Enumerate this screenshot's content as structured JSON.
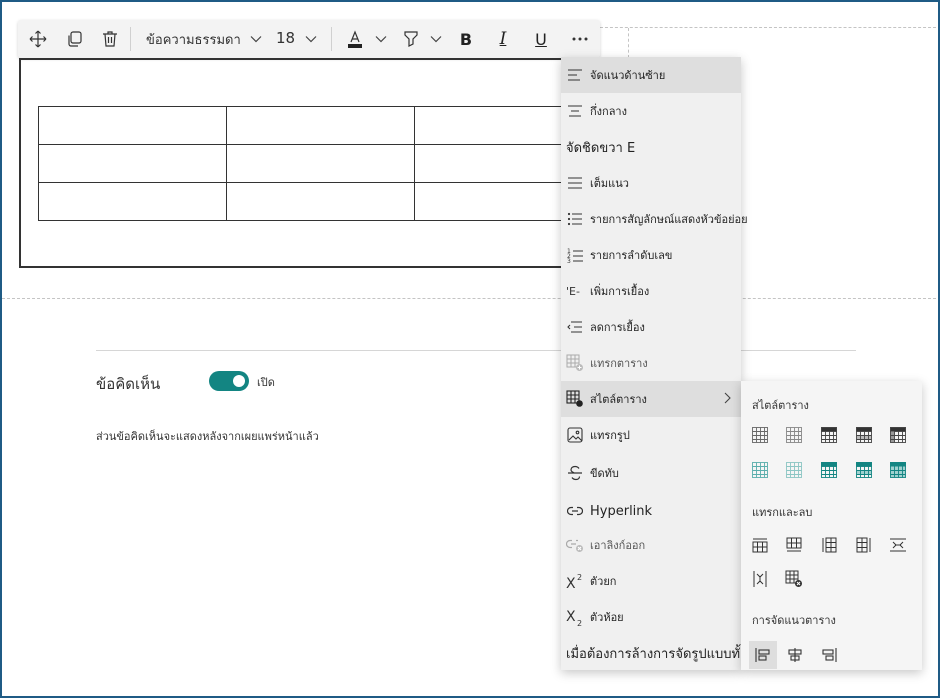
{
  "toolbar": {
    "style_value": "ข้อความธรรมดา",
    "size_value": "18",
    "icons": [
      "move-icon",
      "copy-icon",
      "delete-icon",
      "chevron-down-icon",
      "font-color-icon",
      "highlight-icon",
      "bold-icon",
      "italic-icon",
      "underline-icon",
      "more-icon"
    ]
  },
  "comments": {
    "label": "ข้อคิดเห็น",
    "toggle_label": "เปิด",
    "toggle_on": true,
    "note": "ส่วนข้อคิดเห็นจะแสดงหลังจากเผยแพร่หน้าแล้ว",
    "accent_color": "#138582"
  },
  "menu": {
    "items": [
      {
        "label": "จัดแนวด้านซ้าย",
        "icon": "align-left-icon"
      },
      {
        "label": "กึ่งกลาง",
        "icon": "align-center-icon"
      },
      {
        "label": "จัดชิดขวา E",
        "icon": "align-right-icon"
      },
      {
        "label": "เต็มแนว",
        "icon": "justify-icon"
      },
      {
        "label": "รายการสัญลักษณ์แสดงหัวข้อย่อย",
        "icon": "bullet-list-icon"
      },
      {
        "label": "รายการลำดับเลข",
        "icon": "numbered-list-icon"
      },
      {
        "label": "เพิ่มการเยื้อง",
        "icon": "increase-indent-icon"
      },
      {
        "label": "ลดการเยื้อง",
        "icon": "decrease-indent-icon"
      },
      {
        "label": "แทรกตาราง",
        "icon": "insert-table-icon"
      },
      {
        "label": "สไตล์ตาราง",
        "icon": "table-style-icon"
      },
      {
        "label": "แทรกรูป",
        "icon": "insert-image-icon"
      },
      {
        "label": "ขีดทับ",
        "icon": "strikethrough-icon"
      },
      {
        "label": "Hyperlink",
        "icon": "link-icon"
      },
      {
        "label": "เอาลิงก์ออก",
        "icon": "unlink-icon"
      },
      {
        "label": "ตัวยก",
        "icon": "superscript-icon"
      },
      {
        "label": "ตัวห้อย",
        "icon": "subscript-icon"
      },
      {
        "label": "เมื่อต้องการล้างการจัดรูปแบบทั้งหมด",
        "icon": "clear-format-icon"
      }
    ]
  },
  "submenu": {
    "heading_styles": "สไตล์ตาราง",
    "heading_insert": "แทรกและลบ",
    "heading_align": "การจัดแนวตาราง",
    "style_icons": [
      "table-style-plain-icon",
      "table-style-light-icon",
      "table-style-header-dark-icon",
      "table-style-header-dark-alt-icon",
      "table-style-dark-icon",
      "table-style-teal-plain-icon",
      "table-style-teal-light-icon",
      "table-style-teal-header-icon",
      "table-style-teal-header-alt-icon",
      "table-style-teal-dark-icon"
    ],
    "insert_icons": [
      "insert-row-above-icon",
      "insert-row-below-icon",
      "insert-column-left-icon",
      "insert-column-right-icon",
      "delete-row-icon",
      "delete-column-icon",
      "delete-table-icon"
    ],
    "align_icons": [
      "table-align-left-icon",
      "table-align-center-icon",
      "table-align-right-icon"
    ]
  }
}
